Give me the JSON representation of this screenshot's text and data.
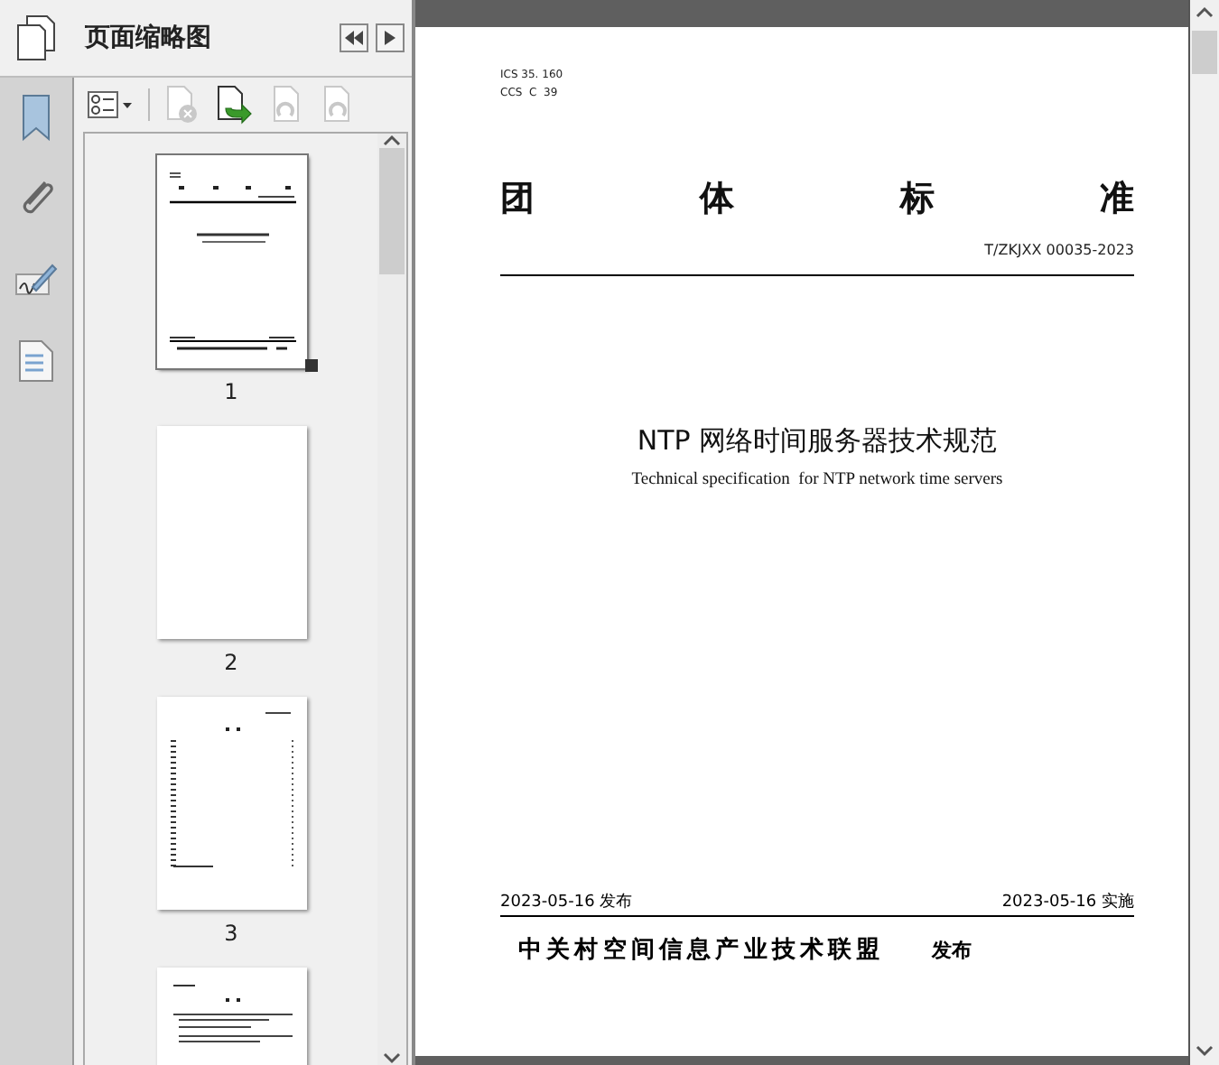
{
  "panel": {
    "title": "页面缩略图"
  },
  "toolbar": [
    {
      "kind": "options",
      "disabled": false
    },
    {
      "kind": "delete",
      "disabled": true
    },
    {
      "kind": "insert",
      "disabled": false
    },
    {
      "kind": "rotate-left",
      "disabled": true
    },
    {
      "kind": "rotate-right",
      "disabled": true
    }
  ],
  "rail": [
    {
      "kind": "bookmark"
    },
    {
      "kind": "attachment"
    },
    {
      "kind": "signature"
    },
    {
      "kind": "layers"
    }
  ],
  "thumbnails": [
    {
      "label": "1",
      "kind": "cover",
      "selected": true
    },
    {
      "label": "2",
      "kind": "blank",
      "selected": false
    },
    {
      "label": "3",
      "kind": "toc",
      "selected": false
    },
    {
      "kind": "foreword",
      "selected": false
    }
  ],
  "document": {
    "codes": [
      "ICS 35. 160",
      "CCS  C  39"
    ],
    "heading": [
      "团",
      "体",
      "标",
      "准"
    ],
    "number": "T/ZKJXX 00035-2023",
    "title": "NTP 网络时间服务器技术规范",
    "subtitle": "Technical specification  for NTP network time servers",
    "publish_date": "2023-05-16 发布",
    "effective_date": "2023-05-16 实施",
    "publisher": "中关村空间信息产业技术联盟",
    "publish_label": "发布"
  }
}
